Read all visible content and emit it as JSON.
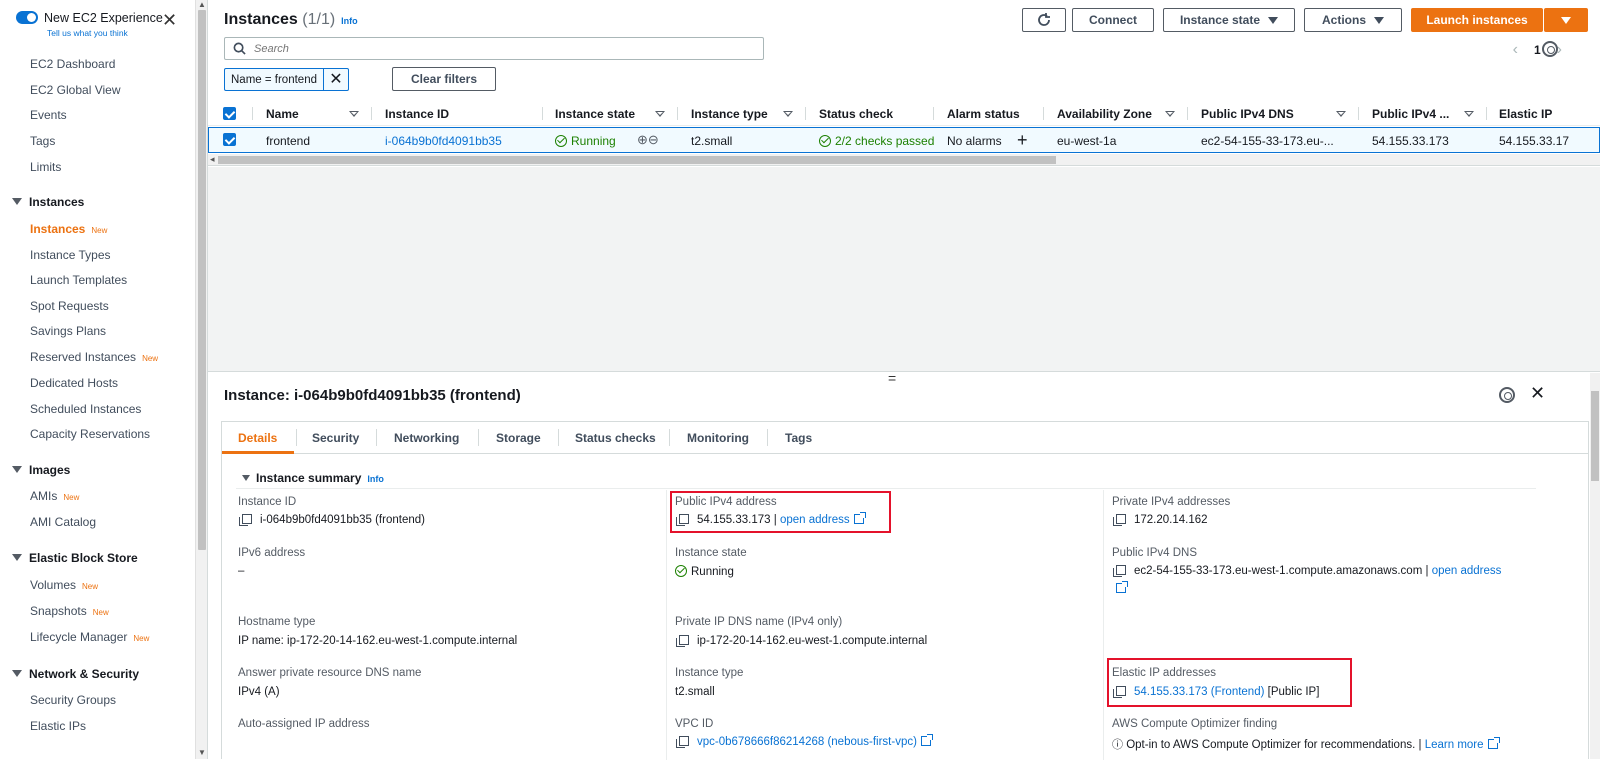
{
  "sidebar": {
    "experience_title": "New EC2 Experience",
    "experience_sub": "Tell us what you think",
    "top_items": [
      "EC2 Dashboard",
      "EC2 Global View",
      "Events",
      "Tags",
      "Limits"
    ],
    "sections": [
      {
        "title": "Instances",
        "items": [
          {
            "label": "Instances",
            "new": "New",
            "active": true
          },
          {
            "label": "Instance Types",
            "new": ""
          },
          {
            "label": "Launch Templates",
            "new": ""
          },
          {
            "label": "Spot Requests",
            "new": ""
          },
          {
            "label": "Savings Plans",
            "new": ""
          },
          {
            "label": "Reserved Instances",
            "new": "New"
          },
          {
            "label": "Dedicated Hosts",
            "new": ""
          },
          {
            "label": "Scheduled Instances",
            "new": ""
          },
          {
            "label": "Capacity Reservations",
            "new": ""
          }
        ]
      },
      {
        "title": "Images",
        "items": [
          {
            "label": "AMIs",
            "new": "New"
          },
          {
            "label": "AMI Catalog",
            "new": ""
          }
        ]
      },
      {
        "title": "Elastic Block Store",
        "items": [
          {
            "label": "Volumes",
            "new": "New"
          },
          {
            "label": "Snapshots",
            "new": "New"
          },
          {
            "label": "Lifecycle Manager",
            "new": "New"
          }
        ]
      },
      {
        "title": "Network & Security",
        "items": [
          {
            "label": "Security Groups",
            "new": ""
          },
          {
            "label": "Elastic IPs",
            "new": ""
          }
        ]
      }
    ]
  },
  "header": {
    "title": "Instances",
    "count": "(1/1)",
    "info": "Info",
    "connect": "Connect",
    "instance_state": "Instance state",
    "actions": "Actions",
    "launch": "Launch instances"
  },
  "search": {
    "placeholder": "Search"
  },
  "pager": {
    "prev": "‹",
    "page": "1",
    "next": "›"
  },
  "filter": {
    "token": "Name = frontend",
    "clear": "Clear filters"
  },
  "table": {
    "columns": [
      "Name",
      "Instance ID",
      "Instance state",
      "Instance type",
      "Status check",
      "Alarm status",
      "Availability Zone",
      "Public IPv4 DNS",
      "Public IPv4 ...",
      "Elastic IP"
    ],
    "row": {
      "name": "frontend",
      "id": "i-064b9b0fd4091bb35",
      "state": "Running",
      "type": "t2.small",
      "status": "2/2 checks passed",
      "alarm": "No alarms",
      "az": "eu-west-1a",
      "dns": "ec2-54-155-33-173.eu-...",
      "ipv4": "54.155.33.173",
      "eip": "54.155.33.17"
    }
  },
  "details": {
    "title": "Instance: i-064b9b0fd4091bb35 (frontend)",
    "tabs": [
      "Details",
      "Security",
      "Networking",
      "Storage",
      "Status checks",
      "Monitoring",
      "Tags"
    ],
    "summary_title": "Instance summary",
    "summary_info": "Info",
    "fields": {
      "instance_id_label": "Instance ID",
      "instance_id_value": "i-064b9b0fd4091bb35 (frontend)",
      "public_ipv4_label": "Public IPv4 address",
      "public_ipv4_value": "54.155.33.173",
      "public_ipv4_sep": "|",
      "open_address": "open address",
      "private_ipv4_label": "Private IPv4 addresses",
      "private_ipv4_value": "172.20.14.162",
      "ipv6_label": "IPv6 address",
      "ipv6_value": "–",
      "instance_state_label": "Instance state",
      "instance_state_value": "Running",
      "public_dns_label": "Public IPv4 DNS",
      "public_dns_value": "ec2-54-155-33-173.eu-west-1.compute.amazonaws.com",
      "public_dns_sep": "|",
      "public_dns_open": "open address",
      "hostname_type_label": "Hostname type",
      "hostname_type_value": "IP name: ip-172-20-14-162.eu-west-1.compute.internal",
      "private_dns_label": "Private IP DNS name (IPv4 only)",
      "private_dns_value": "ip-172-20-14-162.eu-west-1.compute.internal",
      "answer_dns_label": "Answer private resource DNS name",
      "answer_dns_value": "IPv4 (A)",
      "instance_type_label": "Instance type",
      "instance_type_value": "t2.small",
      "elastic_ip_label": "Elastic IP addresses",
      "elastic_ip_value": "54.155.33.173 (Frontend)",
      "elastic_ip_suffix": "[Public IP]",
      "auto_ip_label": "Auto-assigned IP address",
      "vpc_label": "VPC ID",
      "vpc_value": "vpc-0b678666f86214268 (nebous-first-vpc)",
      "optimizer_label": "AWS Compute Optimizer finding",
      "optimizer_value": "Opt-in to AWS Compute Optimizer for recommendations.",
      "optimizer_sep": "|",
      "optimizer_link": "Learn more"
    }
  },
  "colors": {
    "accent": "#ec7211",
    "link": "#0972d3",
    "success": "#1d8102",
    "highlight": "#e4122b"
  }
}
